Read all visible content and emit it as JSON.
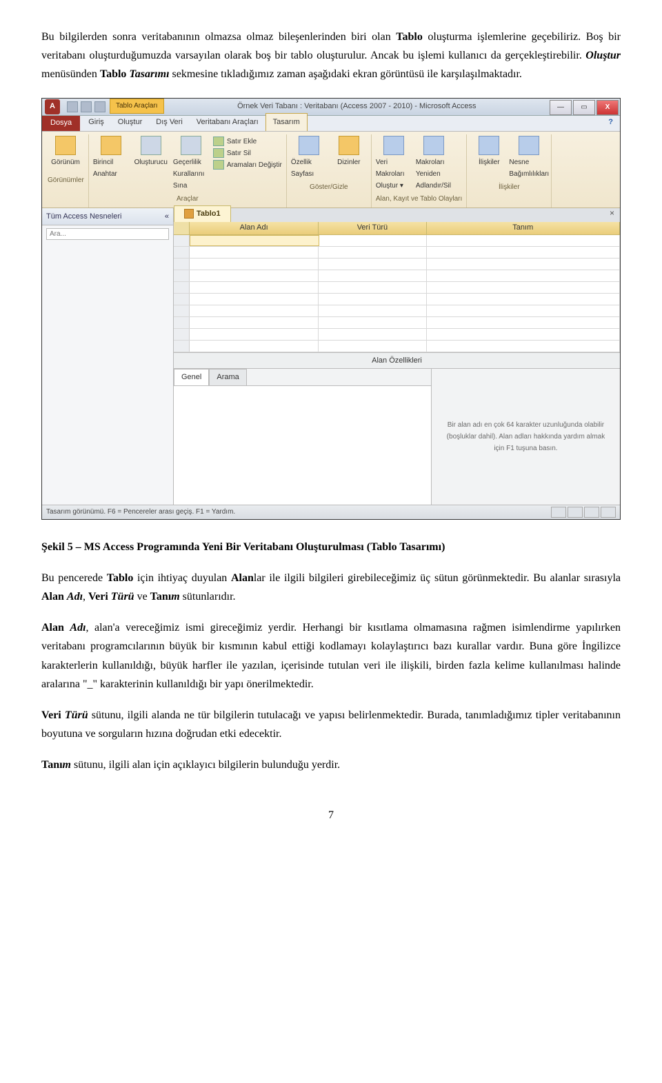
{
  "para1_pre": "Bu bilgilerden sonra veritabanının olmazsa olmaz bileşenlerinden biri olan ",
  "para1_b1": "Tablo",
  "para1_mid1": " oluşturma işlemlerine geçebiliriz. Boş bir veritabanı oluşturduğumuzda varsayılan olarak boş bir tablo oluşturulur. Ancak bu işlemi kullanıcı da gerçekleştirebilir. ",
  "para1_bi1": "Oluştur",
  "para1_mid2": " menüsünden ",
  "para1_b2": "Tablo ",
  "para1_bi2": "Tasarımı",
  "para1_end": " sekmesine tıkladığımız zaman aşağıdaki ekran görüntüsü ile karşılaşılmaktadır.",
  "access": {
    "contextTabLabel": "Tablo Araçları",
    "windowTitle": "Örnek Veri Tabanı : Veritabanı (Access 2007 - 2010)  -  Microsoft Access",
    "appIconLetter": "A",
    "fileTab": "Dosya",
    "menuTabs": [
      "Giriş",
      "Oluştur",
      "Dış Veri",
      "Veritabanı Araçları"
    ],
    "activeMenuTab": "Tasarım",
    "helpSymbol": "?",
    "ribbonGroups": {
      "g1": {
        "btn": "Görünüm",
        "label": "Görünümler"
      },
      "g2": {
        "b1": "Birincil Anahtar",
        "b2": "Oluşturucu",
        "b3": "Geçerlilik Kurallarını Sına",
        "l1": "Satır Ekle",
        "l2": "Satır Sil",
        "l3": "Aramaları Değiştir",
        "label": "Araçlar"
      },
      "g3": {
        "b1": "Özellik Sayfası",
        "b2": "Dizinler",
        "label": "Göster/Gizle"
      },
      "g4": {
        "b1": "Veri Makroları Oluştur ▾",
        "b2": "Makroları Yeniden Adlandır/Sil",
        "label": "Alan, Kayıt ve Tablo Olayları"
      },
      "g5": {
        "b1": "İlişkiler",
        "b2": "Nesne Bağımlılıkları",
        "label": "İlişkiler"
      }
    },
    "navHeader": "Tüm Access Nesneleri",
    "navChev": "«",
    "searchPlaceholder": "Ara...",
    "docTab": "Tablo1",
    "gridHeaders": {
      "fieldName": "Alan Adı",
      "dataType": "Veri Türü",
      "description": "Tanım"
    },
    "propTitle": "Alan Özellikleri",
    "propTabs": {
      "general": "Genel",
      "lookup": "Arama"
    },
    "propHelp": "Bir alan adı en çok 64 karakter uzunluğunda olabilir (boşluklar dahil). Alan adları hakkında yardım almak için F1 tuşuna basın.",
    "statusText": "Tasarım görünümü.  F6 = Pencereler arası geçiş.  F1 = Yardım."
  },
  "caption": "Şekil 5 – MS Access Programında Yeni Bir Veritabanı Oluşturulması (Tablo Tasarımı)",
  "para2_pre": "Bu pencerede ",
  "para2_b1": "Tablo",
  "para2_mid1": " için ihtiyaç duyulan ",
  "para2_b2": "Alan",
  "para2_mid2": "lar ile ilgili bilgileri girebileceğimiz üç sütun görünmektedir. Bu alanlar sırasıyla ",
  "para2_b3": "Alan ",
  "para2_bi3": "Adı",
  "para2_comma": ", ",
  "para2_b4": "Veri ",
  "para2_bi4": "Türü",
  "para2_and": " ve ",
  "para2_b5": "Tanı",
  "para2_bi5": "m",
  "para2_end": " sütunlarıdır.",
  "para3_b1": "Alan ",
  "para3_bi1": "Adı",
  "para3_text": ", alan'a vereceğimiz ismi gireceğimiz yerdir. Herhangi bir kısıtlama olmamasına rağmen isimlendirme yapılırken veritabanı programcılarının büyük bir kısmının kabul ettiği kodlamayı kolaylaştırıcı bazı kurallar vardır. Buna göre İngilizce karakterlerin kullanıldığı, büyük harfler ile yazılan, içerisinde tutulan veri ile ilişkili, birden fazla kelime kullanılması halinde aralarına \"_\" karakterinin kullanıldığı bir yapı önerilmektedir.",
  "para4_b1": "Veri ",
  "para4_bi1": "Türü",
  "para4_text": " sütunu, ilgili alanda ne tür bilgilerin tutulacağı ve yapısı belirlenmektedir. Burada, tanımladığımız tipler veritabanının boyutuna ve sorguların hızına doğrudan etki edecektir.",
  "para5_b1": "Tanı",
  "para5_bi1": "m",
  "para5_text": " sütunu, ilgili alan için açıklayıcı bilgilerin bulunduğu yerdir.",
  "pageNumber": "7"
}
